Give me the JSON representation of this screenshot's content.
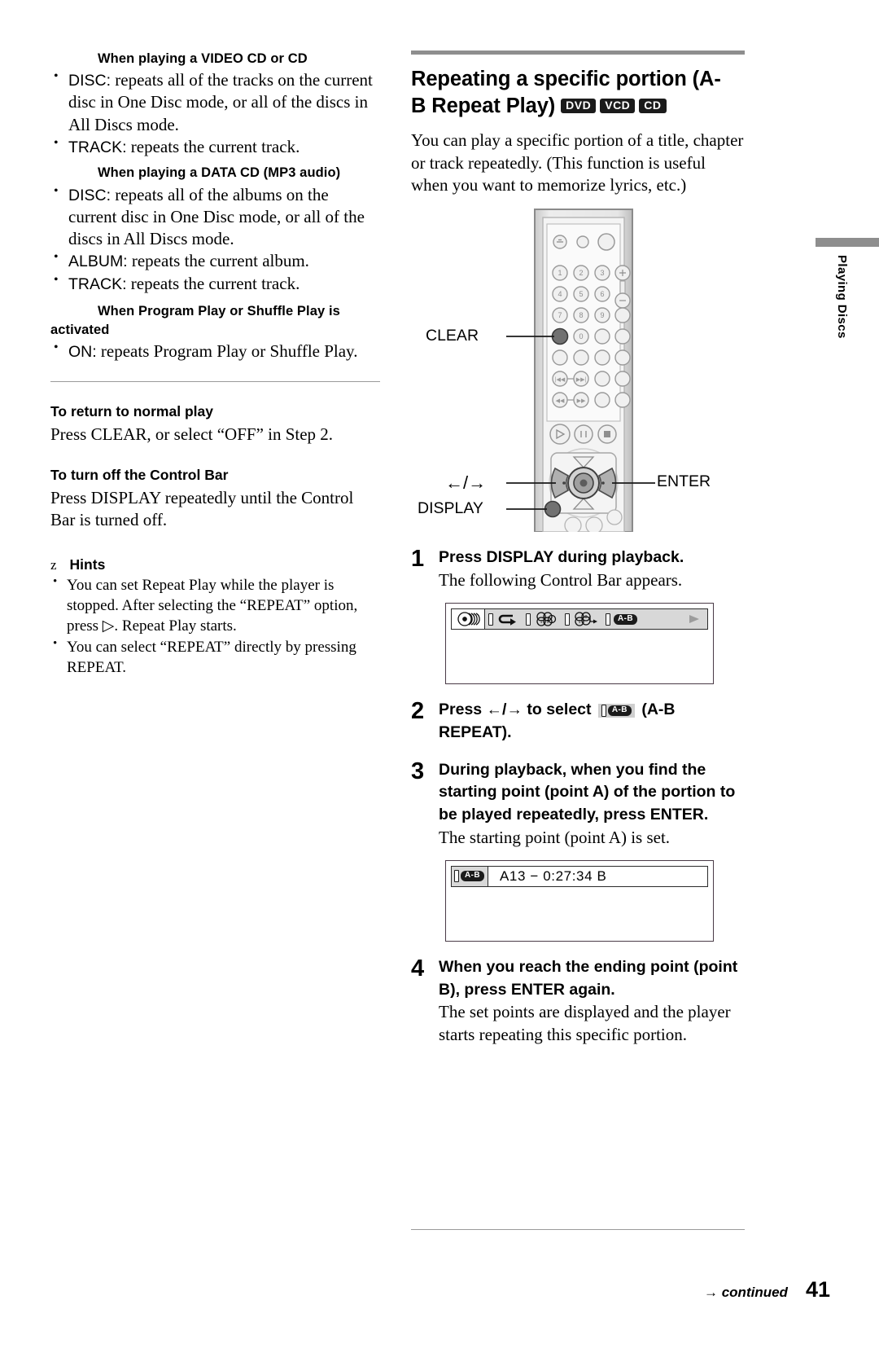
{
  "left_column": {
    "section_video_cd": {
      "heading": "When playing a VIDEO CD or CD",
      "items": [
        {
          "label": "DISC:",
          "text": " repeats all of the tracks on the current disc in One Disc mode, or all of the discs in All Discs mode."
        },
        {
          "label": "TRACK:",
          "text": " repeats the current track."
        }
      ]
    },
    "section_data_cd": {
      "heading": "When playing a DATA CD (MP3 audio)",
      "items": [
        {
          "label": "DISC:",
          "text": " repeats all of the albums on the current disc in One Disc mode, or all of the discs in All Discs mode."
        },
        {
          "label": "ALBUM:",
          "text": " repeats the current album."
        },
        {
          "label": "TRACK:",
          "text": " repeats the current track."
        }
      ]
    },
    "section_program": {
      "heading_line1": "When Program Play or Shuffle Play is",
      "heading_line2": "activated",
      "items": [
        {
          "label": "ON:",
          "text": " repeats Program Play or Shuffle Play."
        }
      ]
    },
    "to_return": {
      "heading": "To return to normal play",
      "body": "Press CLEAR, or select “OFF” in Step 2."
    },
    "to_turn_off": {
      "heading": "To turn off the Control Bar",
      "body": "Press DISPLAY repeatedly until the Control Bar is turned off."
    },
    "hints": {
      "marker": "z",
      "title": "Hints",
      "items": [
        "You can set Repeat Play while the player is stopped. After selecting the “REPEAT” option, press ▷. Repeat Play starts.",
        "You can select “REPEAT” directly by pressing REPEAT."
      ]
    }
  },
  "right_column": {
    "section_title_line1": "Repeating a specific portion (A-",
    "section_title_line2": "B Repeat Play)",
    "media_badges": [
      "DVD",
      "VCD",
      "CD"
    ],
    "intro": "You can play a specific portion of a title, chapter or track repeatedly. (This function is useful when you want to memorize lyrics, etc.)",
    "remote_callouts": {
      "clear": "CLEAR",
      "arrows": "←/→",
      "display": "DISPLAY",
      "enter": "ENTER"
    },
    "steps": [
      {
        "num": "1",
        "bold": "Press DISPLAY during playback.",
        "body": "The following Control Bar appears."
      },
      {
        "num": "2",
        "bold_pre": "Press ←/→ to select",
        "bold_post": "(A-B REPEAT).",
        "icon_label": "A-B"
      },
      {
        "num": "3",
        "bold": "During playback, when you find the starting point (point A) of the portion to be played repeatedly, press ENTER.",
        "body": "The starting point (point A) is set."
      },
      {
        "num": "4",
        "bold": "When you reach the ending point (point B), press ENTER again.",
        "body": "The set points are displayed and the player starts repeating this specific portion."
      }
    ],
    "control_bar": {
      "icons": [
        "disc-stack-icon",
        "repeat-arrow-icon",
        "track-number-icon",
        "chapter-number-icon",
        "ab-repeat-icon"
      ],
      "ab_label": "A-B"
    },
    "ab_display": {
      "tag": "A-B",
      "value": "A13 −  0:27:34  B"
    }
  },
  "side_tab": {
    "label": "Playing Discs"
  },
  "footer": {
    "continued": "→ continued",
    "page_number": "41"
  },
  "colors": {
    "rule_gray": "#8e8e8e",
    "badge_dark": "#1b1b1b",
    "screen_border": "#4a3b47",
    "control_bar_bg": "#d8d8d8"
  }
}
